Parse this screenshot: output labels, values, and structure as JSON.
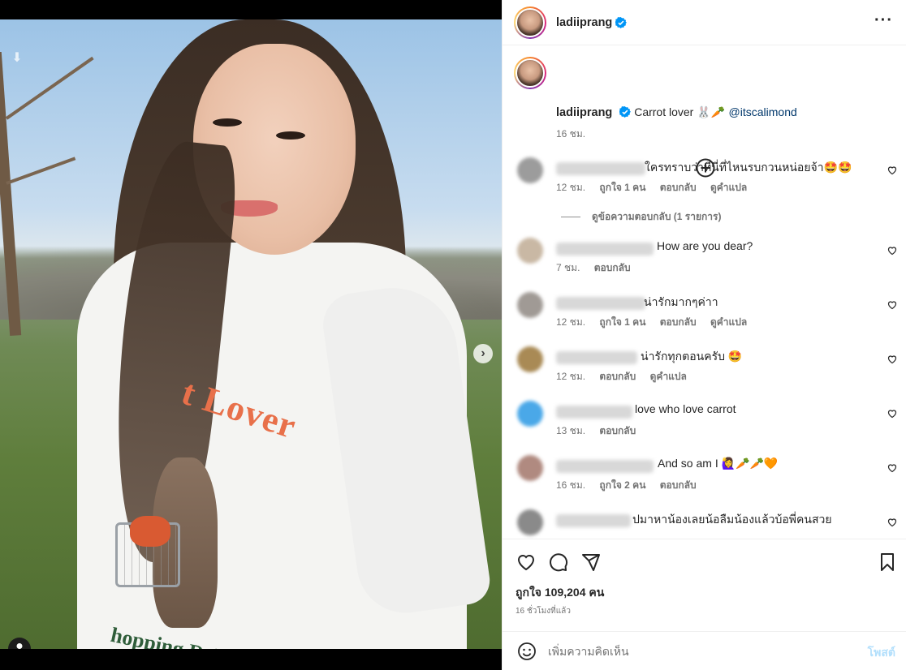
{
  "post": {
    "username": "ladiiprang",
    "caption_text": "Carrot lover 🐰🥕",
    "caption_mention": "@itscalimond",
    "caption_time": "16 ชม.",
    "slide_count": 9,
    "active_slide": 1
  },
  "comments": [
    {
      "text": "ใครทราบว่าที่นี่ที่ไหนรบกวนหน่อยจ้า🤩🤩",
      "time": "12 ชม.",
      "likes": "ถูกใจ 1 คน",
      "reply": "ตอบกลับ",
      "translate": "ดูคำแปล",
      "avatar_color": "#9c9c9c",
      "view_replies": "ดูข้อความตอบกลับ (1 รายการ)"
    },
    {
      "text": "How are you dear?",
      "time": "7 ชม.",
      "likes": "",
      "reply": "ตอบกลับ",
      "translate": "",
      "avatar_color": "#c9b8a4"
    },
    {
      "text": "น่ารักมากๆค่าา",
      "time": "12 ชม.",
      "likes": "ถูกใจ 1 คน",
      "reply": "ตอบกลับ",
      "translate": "ดูคำแปล",
      "avatar_color": "#a09a95"
    },
    {
      "text": "น่ารักทุกตอนครับ 🤩",
      "time": "12 ชม.",
      "likes": "",
      "reply": "ตอบกลับ",
      "translate": "ดูคำแปล",
      "avatar_color": "#a98a55"
    },
    {
      "text": "love who love carrot",
      "time": "13 ชม.",
      "likes": "",
      "reply": "ตอบกลับ",
      "translate": "",
      "avatar_color": "#4aa8e8"
    },
    {
      "text": "And so am I 🙋‍♀️🥕🥕🧡",
      "time": "16 ชม.",
      "likes": "ถูกใจ 2 คน",
      "reply": "ตอบกลับ",
      "translate": "",
      "avatar_color": "#b08a80"
    },
    {
      "text": "ปมาหาน้องเลยน้อลืมน้องแล้วบ้อพี่คนสวย",
      "time": "",
      "likes": "",
      "reply": "",
      "translate": "",
      "avatar_color": "#8a8a8a"
    }
  ],
  "footer": {
    "likes_count": "ถูกใจ 109,204 คน",
    "time_ago": "16 ชั่วโมงที่แล้ว",
    "comment_placeholder": "เพิ่มความคิดเห็น",
    "post_label": "โพสต์"
  },
  "colors": {
    "verified": "#0095f6",
    "post_button_disabled": "#b2dffc",
    "mention": "#00376b"
  },
  "icons": [
    "download-icon",
    "next-arrow-icon",
    "user-tag-icon",
    "more-icon",
    "verified-icon",
    "plus-circle-icon",
    "heart-icon",
    "comment-icon",
    "share-icon",
    "bookmark-icon",
    "emoji-icon"
  ]
}
